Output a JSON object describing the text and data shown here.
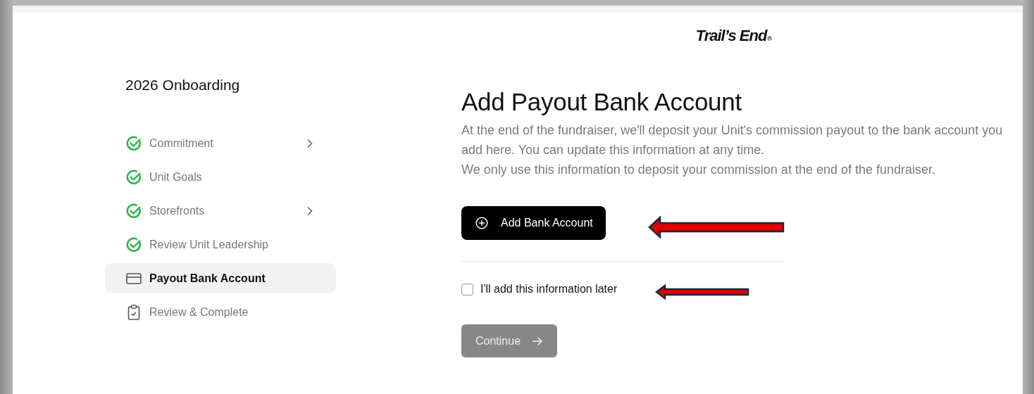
{
  "logo": {
    "text": "Trail’s End",
    "mark": "®"
  },
  "sidebar": {
    "title": "2026 Onboarding",
    "items": [
      {
        "label": "Commitment",
        "kind": "complete",
        "has_submenu": true,
        "selected": false
      },
      {
        "label": "Unit Goals",
        "kind": "complete",
        "has_submenu": false,
        "selected": false
      },
      {
        "label": "Storefronts",
        "kind": "complete",
        "has_submenu": true,
        "selected": false
      },
      {
        "label": "Review Unit Leadership",
        "kind": "complete",
        "has_submenu": false,
        "selected": false
      },
      {
        "label": "Payout Bank Account",
        "kind": "bank",
        "has_submenu": false,
        "selected": true
      },
      {
        "label": "Review & Complete",
        "kind": "review",
        "has_submenu": false,
        "selected": false
      }
    ]
  },
  "main": {
    "heading": "Add Payout Bank Account",
    "paragraphs": [
      "At the end of the fundraiser, we'll deposit your Unit's commission payout to the bank account you add here. You can update this information at any time.",
      "We only use this information to deposit your commission at the end of the fundraiser."
    ],
    "add_button": {
      "label": "Add Bank Account"
    },
    "later_checkbox": {
      "label": "I'll add this information later",
      "checked": false
    },
    "continue_button": {
      "label": "Continue",
      "disabled": true
    }
  }
}
